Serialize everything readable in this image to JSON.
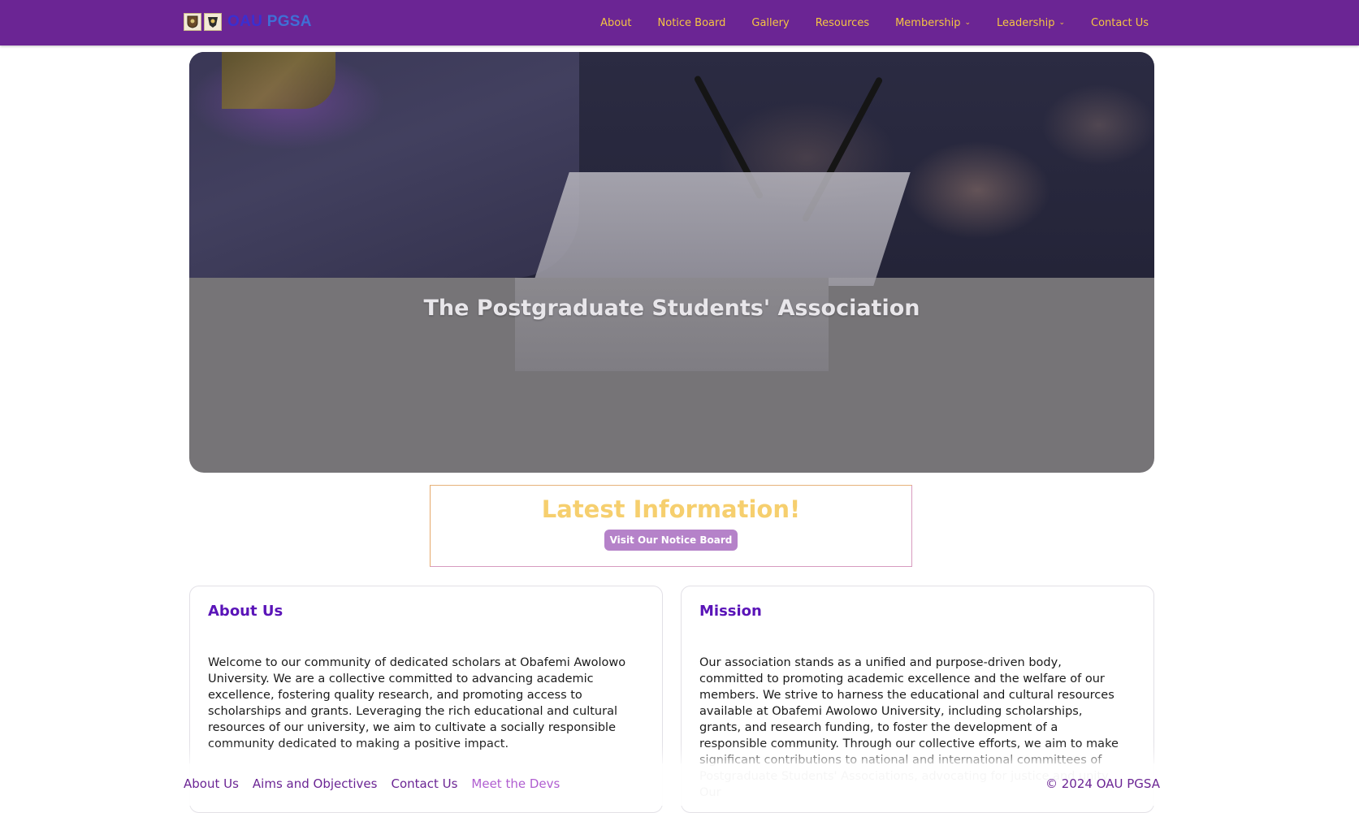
{
  "navbar": {
    "brand": {
      "part1": "OAU",
      "part2": "PGSA"
    },
    "logos": [
      "crest-logo-icon",
      "pgsa-logo-icon"
    ],
    "links": [
      {
        "label": "About",
        "has_dropdown": false
      },
      {
        "label": "Notice Board",
        "has_dropdown": false
      },
      {
        "label": "Gallery",
        "has_dropdown": false
      },
      {
        "label": "Resources",
        "has_dropdown": false
      },
      {
        "label": "Membership",
        "has_dropdown": true
      },
      {
        "label": "Leadership",
        "has_dropdown": true
      },
      {
        "label": "Contact Us",
        "has_dropdown": false
      }
    ],
    "chevron": "⌄"
  },
  "hero": {
    "title": "The Postgraduate Students' Association"
  },
  "latest": {
    "title": "Latest Information!",
    "button_label": "Visit Our Notice Board"
  },
  "cards": {
    "about": {
      "title": "About Us",
      "body": "Welcome to our community of dedicated scholars at Obafemi Awolowo University. We are a collective committed to advancing academic excellence, fostering quality research, and promoting access to scholarships and grants. Leveraging the rich educational and cultural resources of our university, we aim to cultivate a socially responsible community dedicated to making a positive impact."
    },
    "mission": {
      "title": "Mission",
      "body": "Our association stands as a unified and purpose-driven body, committed to promoting academic excellence and the welfare of our members. We strive to harness the educational and cultural resources available at Obafemi Awolowo University, including scholarships, grants, and research funding, to foster the development of a responsible community. Through our collective efforts, we aim to make significant contributions to national and international committees of Postgraduate Students' Associations, advocating for justice and unity. Our"
    }
  },
  "footer": {
    "links": [
      "About Us",
      "Aims and Objectives",
      "Contact Us",
      "Meet the Devs"
    ],
    "copyright": "© 2024 OAU PGSA"
  },
  "colors": {
    "navbar_bg": "#6b2594",
    "nav_link": "#f5c542",
    "card_title": "#5a14b8",
    "latest_title": "#f6cf6e",
    "button_bg": "#b582c9"
  }
}
